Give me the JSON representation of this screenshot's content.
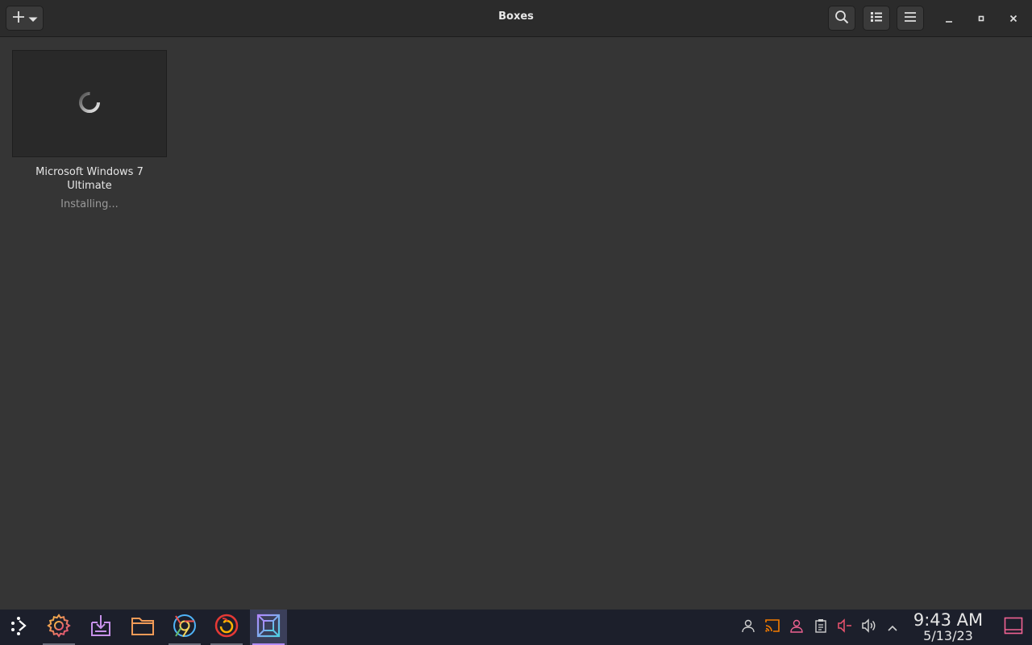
{
  "window": {
    "title": "Boxes"
  },
  "header": {
    "new_icon": "plus-icon",
    "new_menu_icon": "chevron-down-icon",
    "search_icon": "search-icon",
    "view_icon": "list-view-icon",
    "menu_icon": "hamburger-menu-icon",
    "minimize_icon": "minimize-icon",
    "maximize_icon": "maximize-icon",
    "close_icon": "close-icon"
  },
  "boxes": [
    {
      "name": "Microsoft Windows 7 Ultimate",
      "status": "Installing...",
      "thumbnail_icon": "loading-spinner-icon"
    }
  ],
  "taskbar": {
    "apps": [
      {
        "name": "launcher",
        "icon": "app-launcher-icon",
        "running": false
      },
      {
        "name": "settings",
        "icon": "settings-gear-icon",
        "running": true
      },
      {
        "name": "software",
        "icon": "software-center-icon",
        "running": false
      },
      {
        "name": "files",
        "icon": "folder-icon",
        "running": false
      },
      {
        "name": "browser",
        "icon": "chrome-browser-icon",
        "running": true
      },
      {
        "name": "firefox",
        "icon": "firefox-icon",
        "running": true
      },
      {
        "name": "boxes",
        "icon": "boxes-icon",
        "running": true,
        "active": true
      }
    ],
    "tray": [
      "user-icon",
      "cast-icon",
      "account-icon",
      "clipboard-icon",
      "microphone-muted-icon",
      "volume-icon",
      "chevron-up-icon"
    ],
    "clock": {
      "time": "9:43 AM",
      "date": "5/13/23"
    },
    "show_desktop_icon": "show-desktop-icon"
  },
  "colors": {
    "background": "#353535",
    "header": "#2b2b2b",
    "taskbar": "#1c1f2b",
    "accent": "#b18cf5"
  }
}
